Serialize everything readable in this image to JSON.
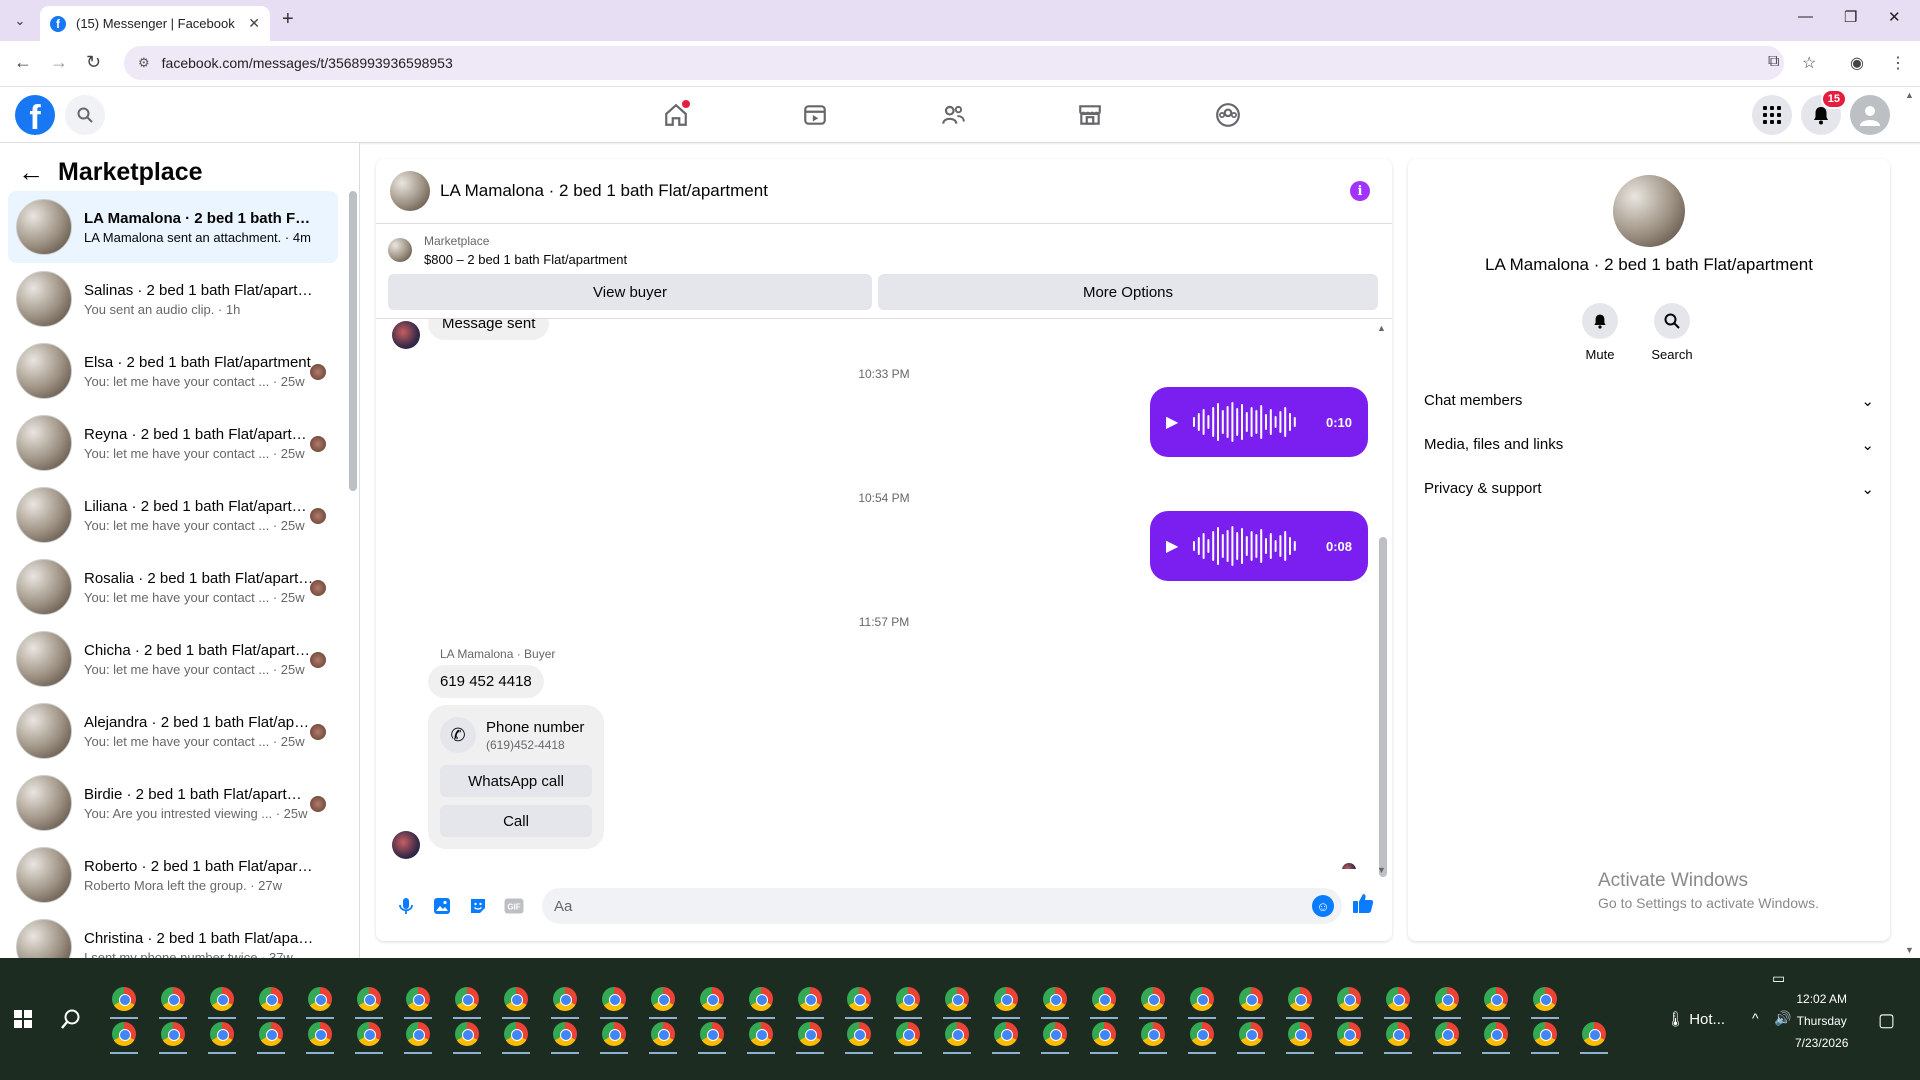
{
  "browser": {
    "tab_title": "(15) Messenger | Facebook",
    "url": "facebook.com/messages/t/3568993936598953"
  },
  "fb": {
    "notif_count": "15"
  },
  "left": {
    "title": "Marketplace",
    "conversations": [
      {
        "name": "LA Mamalona · 2 bed 1 bath Flat/apartment",
        "sub": "LA Mamalona sent an attachment. · 4m",
        "active": true
      },
      {
        "name": "Salinas · 2 bed 1 bath Flat/apartment",
        "sub": "You sent an audio clip. · 1h"
      },
      {
        "name": "Elsa · 2 bed 1 bath Flat/apartment",
        "sub": "You: let me have your contact ... · 25w"
      },
      {
        "name": "Reyna · 2 bed 1 bath Flat/apartment",
        "sub": "You: let me have your contact ... · 25w"
      },
      {
        "name": "Liliana · 2 bed 1 bath Flat/apartment",
        "sub": "You: let me have your contact ... · 25w"
      },
      {
        "name": "Rosalia · 2 bed 1 bath Flat/apartment",
        "sub": "You: let me have your contact ... · 25w"
      },
      {
        "name": "Chicha · 2 bed 1 bath Flat/apartment",
        "sub": "You: let me have your contact ... · 25w"
      },
      {
        "name": "Alejandra · 2 bed 1 bath Flat/apartment",
        "sub": "You: let me have your contact ... · 25w"
      },
      {
        "name": "Birdie · 2 bed 1 bath Flat/apartment",
        "sub": "You: Are you intrested viewing ... · 25w"
      },
      {
        "name": "Roberto · 2 bed 1 bath Flat/apartment",
        "sub": "Roberto Mora left the group. · 27w"
      },
      {
        "name": "Christina · 2 bed 1 bath Flat/apartment",
        "sub": "I sent my phone number twice · 37w"
      }
    ]
  },
  "chat": {
    "title": "LA Mamalona · 2 bed 1 bath Flat/apartment",
    "marketplace_label": "Marketplace",
    "listing": "$800 – 2 bed 1 bath Flat/apartment",
    "view_buyer": "View buyer",
    "more_options": "More Options",
    "message_sent": "Message sent",
    "time1": "10:33 PM",
    "audio1_duration": "0:10",
    "time2": "10:54 PM",
    "audio2_duration": "0:08",
    "time3": "11:57 PM",
    "buyer_label": "LA Mamalona · Buyer",
    "phone_text": "619 452 4418",
    "phone_card_title": "Phone number",
    "phone_card_number": "(619)452-4418",
    "whatsapp_call": "WhatsApp call",
    "call": "Call",
    "composer_placeholder": "Aa"
  },
  "right": {
    "title": "LA Mamalona · 2 bed 1 bath Flat/apartment",
    "mute": "Mute",
    "search": "Search",
    "sections": [
      "Chat members",
      "Media, files and links",
      "Privacy & support"
    ]
  },
  "watermark": {
    "line1": "Activate Windows",
    "line2": "Go to Settings to activate Windows."
  },
  "taskbar": {
    "weather": "Hot...",
    "time": "12:02 AM",
    "day": "Thursday",
    "date": "7/23/2026"
  },
  "colors": {
    "fb_blue": "#1877f2",
    "audio_purple": "#7a1ff0",
    "active_conv": "#ebf5ff"
  }
}
